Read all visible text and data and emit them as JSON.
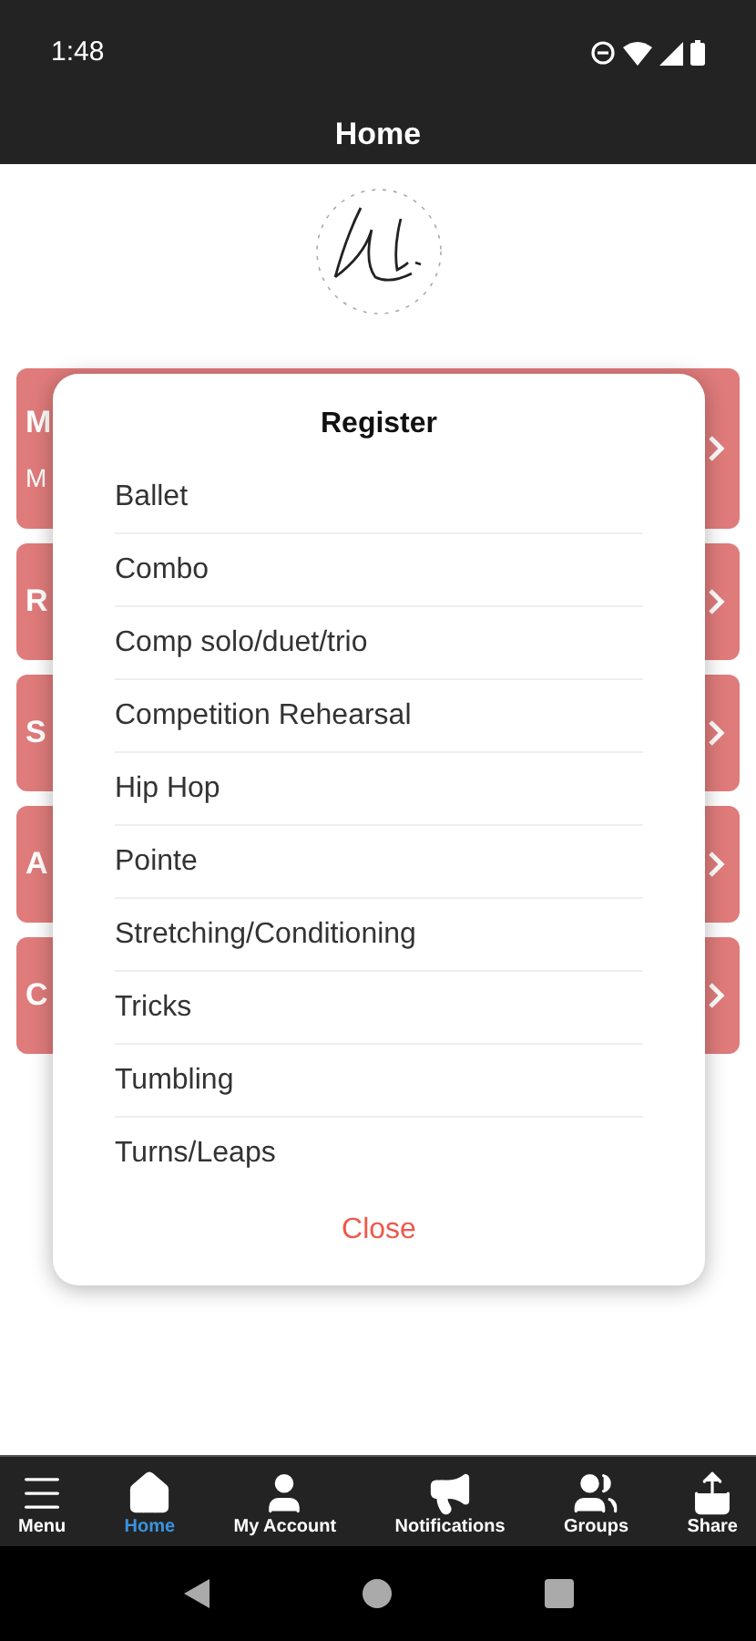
{
  "status_bar": {
    "time": "1:48"
  },
  "header": {
    "title": "Home"
  },
  "cards": [
    {
      "title": "M",
      "subtitle": "M"
    },
    {
      "title": "R"
    },
    {
      "title": "S"
    },
    {
      "title": "A"
    },
    {
      "title": "C"
    }
  ],
  "dialog": {
    "title": "Register",
    "options": [
      "Ballet",
      "Combo",
      "Comp solo/duet/trio",
      "Competition Rehearsal",
      "Hip Hop",
      "Pointe",
      "Stretching/Conditioning",
      "Tricks",
      "Tumbling",
      "Turns/Leaps"
    ],
    "close": "Close"
  },
  "tab_bar": [
    {
      "kind": "menu",
      "label": "Menu",
      "selected": false
    },
    {
      "kind": "home",
      "label": "Home",
      "selected": true
    },
    {
      "kind": "account",
      "label": "My Account",
      "selected": false
    },
    {
      "kind": "notifications",
      "label": "Notifications",
      "selected": false
    },
    {
      "kind": "groups",
      "label": "Groups",
      "selected": false
    },
    {
      "kind": "share",
      "label": "Share",
      "selected": false
    }
  ]
}
